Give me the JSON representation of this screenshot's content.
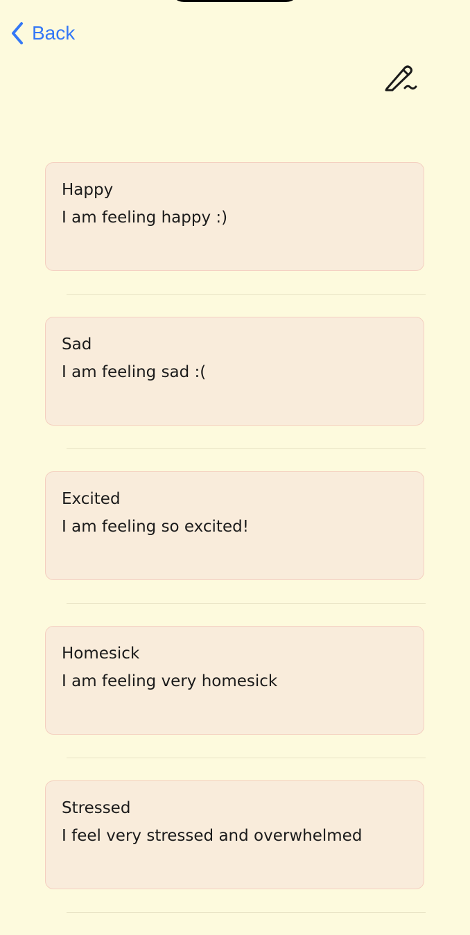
{
  "nav": {
    "back_label": "Back",
    "back_icon": "chevron-left-icon",
    "compose_icon": "pencil-signature-icon",
    "accent_color": "#3478f6"
  },
  "colors": {
    "background": "#fdfadd",
    "card_fill": "#f9ecdb",
    "card_border": "#f4cfc0"
  },
  "entries": [
    {
      "title": "Happy",
      "text": "I am feeling happy :)"
    },
    {
      "title": "Sad",
      "text": "I am feeling sad :("
    },
    {
      "title": "Excited",
      "text": "I am feeling so excited!"
    },
    {
      "title": "Homesick",
      "text": "I am feeling very homesick"
    },
    {
      "title": "Stressed",
      "text": "I feel very stressed and overwhelmed"
    }
  ]
}
